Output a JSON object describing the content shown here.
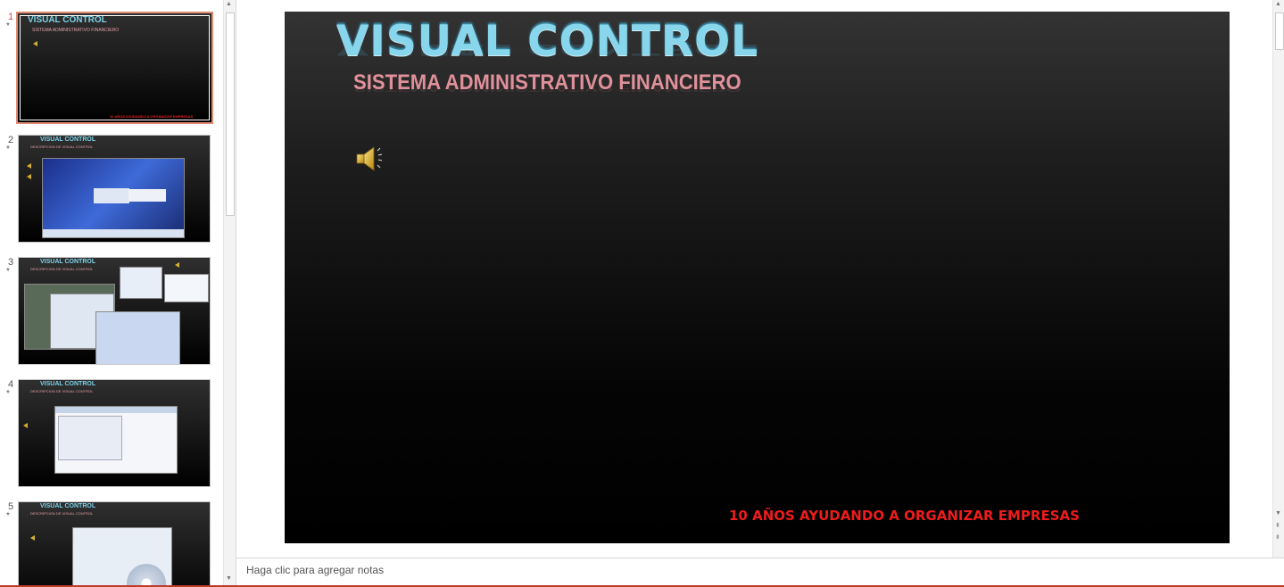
{
  "thumbnails": [
    {
      "number": "1",
      "title": "VISUAL CONTROL",
      "subtitle": "SISTEMA ADMINISTRATIVO FINANCIERO",
      "footer": "10 AÑOS AYUDANDO A ORGANIZAR EMPRESAS",
      "selected": true
    },
    {
      "number": "2",
      "title": "VISUAL CONTROL",
      "subtitle": "DESCRIPCION DE VISUAL CONTROL"
    },
    {
      "number": "3",
      "title": "VISUAL CONTROL",
      "subtitle": "DESCRIPCION DE VISUAL CONTROL"
    },
    {
      "number": "4",
      "title": "VISUAL CONTROL",
      "subtitle": "DESCRIPCION DE VISUAL CONTROL"
    },
    {
      "number": "5",
      "title": "VISUAL CONTROL",
      "subtitle": "DESCRIPCION DE VISUAL CONTROL"
    }
  ],
  "star_glyph": "*",
  "slide": {
    "title": "VISUAL CONTROL",
    "subtitle": "SISTEMA ADMINISTRATIVO FINANCIERO",
    "footer": "10 AÑOS AYUDANDO A ORGANIZAR EMPRESAS",
    "audio_icon": "speaker-icon"
  },
  "notes": {
    "placeholder": "Haga clic para agregar notas"
  },
  "colors": {
    "title": "#88d6ec",
    "subtitle": "#e0909a",
    "footer": "#ee1c1c",
    "selected_border": "#e08a74",
    "accent_rule": "#c0392b"
  }
}
